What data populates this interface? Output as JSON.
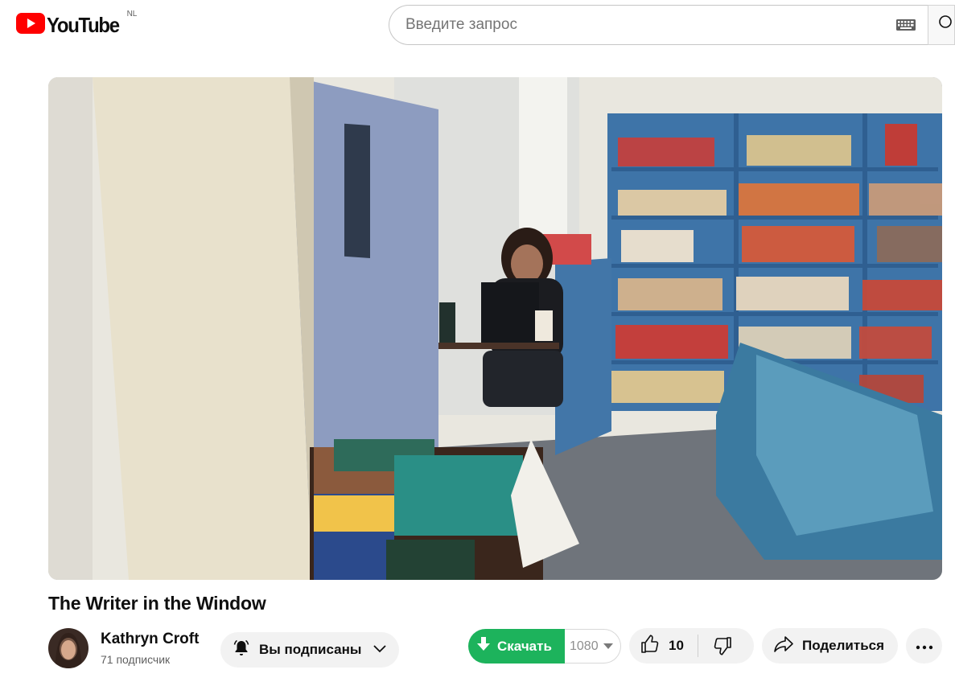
{
  "header": {
    "logo_text": "YouTube",
    "logo_region": "NL",
    "search_placeholder": "Введите запрос"
  },
  "video": {
    "title": "The Writer in the Window"
  },
  "channel": {
    "name": "Kathryn Croft",
    "subscribers": "71 подписчик",
    "subscribed_label": "Вы подписаны"
  },
  "actions": {
    "download_label": "Скачать",
    "download_quality": "1080",
    "like_count": "10",
    "share_label": "Поделиться"
  },
  "colors": {
    "brand_red": "#ff0000",
    "download_green": "#1db35c",
    "pill_bg": "#f2f2f2"
  },
  "icons": [
    "youtube-logo-icon",
    "keyboard-icon",
    "search-icon",
    "bell-icon",
    "chevron-down-icon",
    "download-arrow-icon",
    "caret-down-icon",
    "thumbs-up-icon",
    "thumbs-down-icon",
    "share-icon",
    "more-icon"
  ]
}
